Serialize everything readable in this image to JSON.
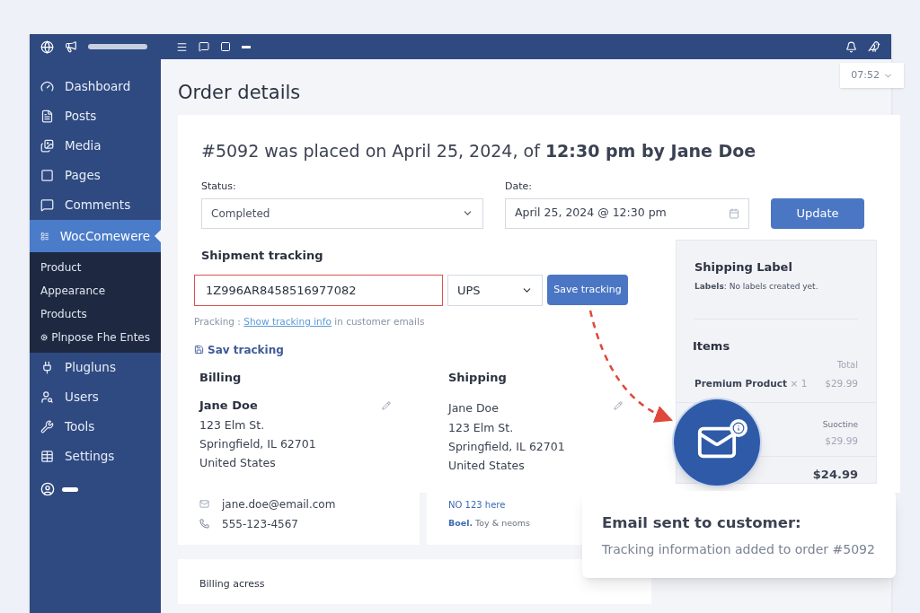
{
  "sidebar": {
    "items": [
      {
        "label": "Dashboard",
        "selected": false
      },
      {
        "label": "Posts",
        "selected": false
      },
      {
        "label": "Media",
        "selected": false
      },
      {
        "label": "Pages",
        "selected": false
      },
      {
        "label": "Comments",
        "selected": false
      },
      {
        "label": "WocComewere",
        "selected": true,
        "children": [
          {
            "label": "Product"
          },
          {
            "label": "Appearance"
          },
          {
            "label": "Products"
          },
          {
            "label": "Plnpose Fhe Entes"
          }
        ]
      },
      {
        "label": "Plugluns",
        "selected": false
      },
      {
        "label": "Users",
        "selected": false
      },
      {
        "label": "Tools",
        "selected": false
      },
      {
        "label": "Settings",
        "selected": false
      }
    ]
  },
  "time_menu": {
    "label": "07:52"
  },
  "page_title": "Order details",
  "order": {
    "heading": "#5092 was placed on April 25, 2024, of **12:30 pm by Jane Doe**",
    "status": {
      "label": "Status:",
      "value": "Completed"
    },
    "date": {
      "label": "Date:",
      "value": "April 25, 2024 @ 12:30 pm"
    },
    "update_button": "Update"
  },
  "shipment_tracking": {
    "title": "Shipment tracking",
    "tracking_number": "1Z996AR8458516977082",
    "highlighted": true,
    "carrier": "UPS",
    "save_button": "Save tracking",
    "note_prefix": "Pracking :",
    "note_link": "Show tracking info",
    "note_suffix": "in customer emails",
    "save_link": "Sav tracking"
  },
  "shipping_label": {
    "title": "Shipping Label",
    "text": "**Labels**: No labels created yet."
  },
  "items": {
    "title": "Items",
    "total_heading": "Total",
    "rows": [
      {
        "name": "Premium Product",
        "qty": "× 1",
        "price": "$29.99"
      }
    ],
    "subtotal_label": "Suoctine",
    "subtotal": "$29.99",
    "total": "$24.99"
  },
  "billing": {
    "title": "Billing",
    "name": "Jane Doe",
    "lines": [
      "123 Elm St.",
      "Springfield, IL 62701",
      "United States"
    ]
  },
  "shipping": {
    "title": "Shipping",
    "name": "Jane Doe",
    "lines": [
      "123 Elm St.",
      "Springfield, IL 62701",
      "United States"
    ]
  },
  "contact": {
    "email": "jane.doe@email.com",
    "phone": "555-123-4567"
  },
  "shipping_extra": {
    "line": "NO 123 here",
    "link": "Boel.",
    "text": "Toy & neoms"
  },
  "billing_address": {
    "title": "Billing acress"
  },
  "toast": {
    "title": "Email sent to customer:",
    "message": "Tracking information added to order #5092"
  }
}
